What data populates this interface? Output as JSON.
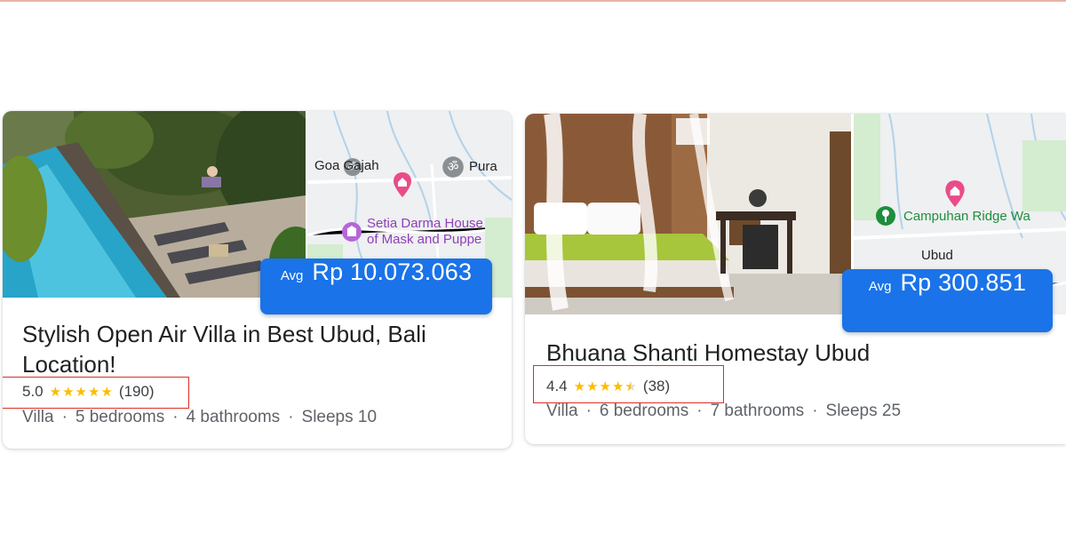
{
  "colors": {
    "price_pill": "#1a73e8",
    "star": "#fbbc04",
    "highlight": "#d93025",
    "title_text": "#202124",
    "meta_text": "#5f6368"
  },
  "listings": [
    {
      "title": "Stylish Open Air Villa in Best Ubud, Bali Location!",
      "price_prefix": "Avg",
      "price": "Rp 10.073.063",
      "rating": "5.0",
      "star_fill": [
        1,
        1,
        1,
        1,
        1
      ],
      "review_count": "(190)",
      "details": [
        "Villa",
        "5 bedrooms",
        "4 bathrooms",
        "Sleeps 10"
      ],
      "photo": "outdoor-pool-with-loungers",
      "map_labels": [
        "Goa Gajah",
        "Pura",
        "Setia Darma House",
        "of Mask and Puppe"
      ],
      "map_icons": [
        "temple-icon",
        "temple-icon",
        "home-pin-icon",
        "museum-icon"
      ]
    },
    {
      "title": "Bhuana Shanti Homestay Ubud",
      "price_prefix": "Avg",
      "price": "Rp 300.851",
      "rating": "4.4",
      "star_fill": [
        1,
        1,
        1,
        1,
        0.5
      ],
      "review_count": "(38)",
      "details": [
        "Villa",
        "6 bedrooms",
        "7 bathrooms",
        "Sleeps 25"
      ],
      "photo": "bedroom-with-canopy-bed",
      "map_labels": [
        "Campuhan Ridge Wa",
        "Ubud"
      ],
      "map_icons": [
        "home-pin-icon",
        "park-icon"
      ]
    }
  ]
}
